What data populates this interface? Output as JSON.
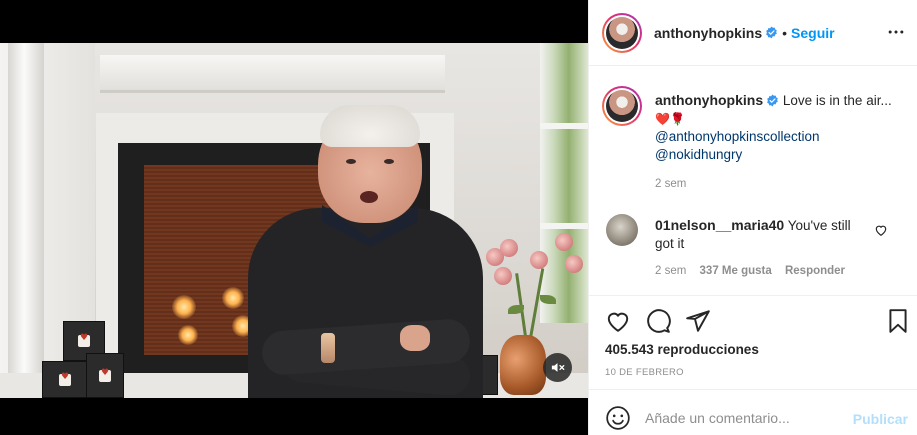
{
  "post": {
    "username": "anthonyhopkins",
    "verified": true,
    "follow_label": "Seguir",
    "separator": "•",
    "more_icon": "more-horizontal-icon",
    "caption": {
      "username": "anthonyhopkins",
      "text": "Love is in the air...",
      "emojis": "❤️🌹",
      "mentions": [
        "@anthonyhopkinscollection",
        "@nokidhungry"
      ],
      "time": "2 sem"
    },
    "comments": [
      {
        "username": "01nelson__maria40",
        "text": "You've still got it",
        "time": "2 sem",
        "likes": "337 Me gusta",
        "reply_label": "Responder"
      }
    ],
    "views": "405.543 reproducciones",
    "date": "10 DE FEBRERO",
    "comment_input": {
      "placeholder": "Añade un comentario...",
      "publish_label": "Publicar"
    }
  },
  "colors": {
    "accent": "#0095f6",
    "mention": "#00376b",
    "muted": "#8e8e8e",
    "publish_disabled": "#b2dffc"
  }
}
